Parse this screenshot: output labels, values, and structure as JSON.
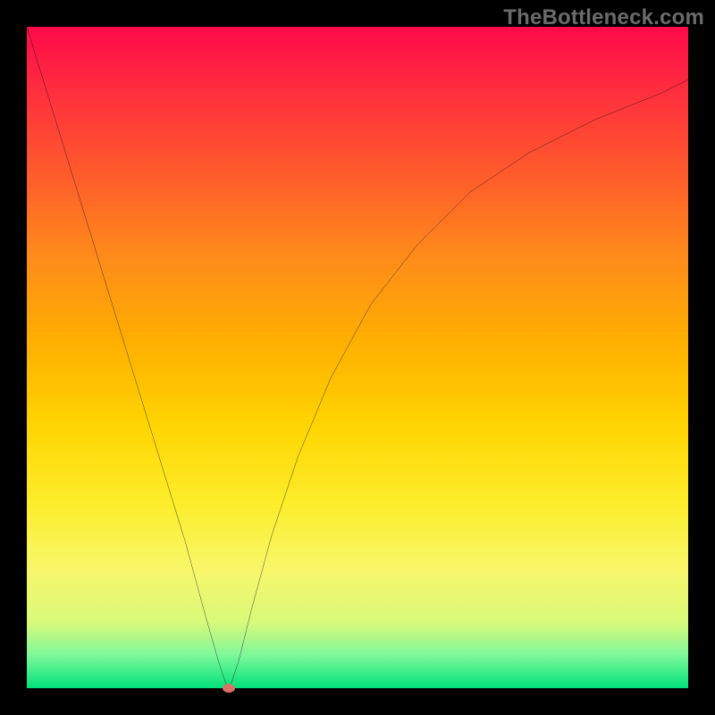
{
  "watermark": {
    "text": "TheBottleneck.com"
  },
  "chart_data": {
    "type": "line",
    "title": "",
    "xlabel": "",
    "ylabel": "",
    "xlim": [
      0,
      100
    ],
    "ylim": [
      0,
      100
    ],
    "grid": false,
    "legend": false,
    "background_gradient": {
      "top": "#ff0a4a",
      "bottom": "#00e27a",
      "description": "vertical red-to-green heat gradient"
    },
    "series": [
      {
        "name": "bottleneck-curve",
        "color": "#000000",
        "x": [
          0,
          4,
          8,
          12,
          16,
          20,
          24,
          27,
          29,
          30,
          30.5,
          31,
          32,
          34,
          37,
          41,
          46,
          52,
          59,
          67,
          76,
          86,
          96,
          100
        ],
        "y": [
          100,
          87,
          74,
          61,
          48,
          35,
          22,
          11,
          4,
          1,
          0,
          1,
          4,
          12,
          23,
          35,
          47,
          58,
          67,
          75,
          81,
          86,
          90,
          92
        ]
      }
    ],
    "marker": {
      "name": "optimal-point",
      "x": 30.5,
      "y": 0,
      "color": "#d9726b"
    }
  }
}
